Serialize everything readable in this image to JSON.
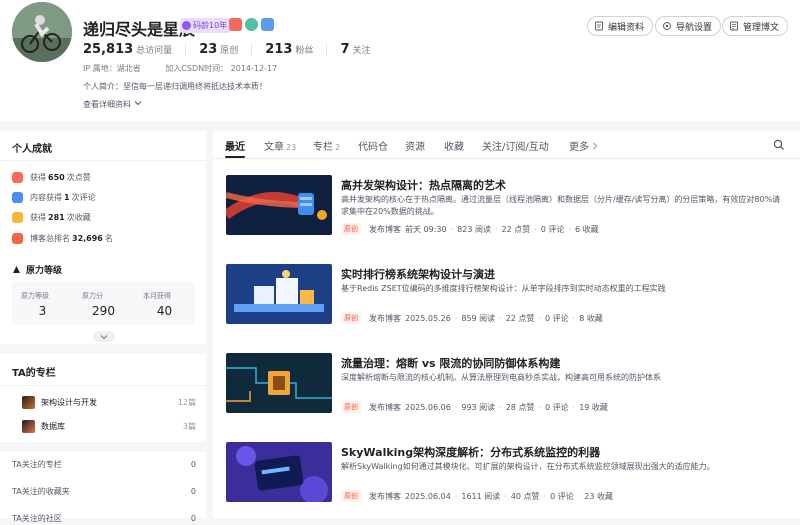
{
  "profile": {
    "name": "递归尽头是星辰",
    "age_badge": "码龄10年",
    "stats": [
      {
        "num": "25,813",
        "label": "总访问量"
      },
      {
        "num": "23",
        "label": "原创"
      },
      {
        "num": "213",
        "label": "粉丝"
      },
      {
        "num": "7",
        "label": "关注"
      }
    ],
    "ip": "IP 属地：湖北省",
    "joined": "加入CSDN时间： 2014-12-17",
    "bio": "个人简介：坚信每一层递归调用终将抵达技术本质！",
    "more_info": "查看详细资料"
  },
  "header_buttons": {
    "edit": "编辑资料",
    "nav": "导航设置",
    "manage": "管理博文"
  },
  "achievements": {
    "title": "个人成就",
    "items": [
      {
        "pre": "获得",
        "num": "650",
        "post": "次点赞",
        "color": "#ff6b5a"
      },
      {
        "pre": "内容获得",
        "num": "1",
        "post": "次评论",
        "color": "#4e8bf5"
      },
      {
        "pre": "获得",
        "num": "281",
        "post": "次收藏",
        "color": "#f6b73c"
      },
      {
        "pre": "博客总排名",
        "num": "32,696",
        "post": "名",
        "color": "#f5683d"
      }
    ],
    "level_title": "原力等级",
    "level": [
      {
        "label": "原力等级",
        "value": "3"
      },
      {
        "label": "原力分",
        "value": "290"
      },
      {
        "label": "本月获得",
        "value": "40"
      }
    ]
  },
  "columns": {
    "title": "TA的专栏",
    "items": [
      {
        "name": "架构设计与开发",
        "count": "12篇"
      },
      {
        "name": "数据库",
        "count": "3篇"
      }
    ]
  },
  "follows": [
    {
      "label": "TA关注的专栏",
      "count": "0"
    },
    {
      "label": "TA关注的收藏夹",
      "count": "0"
    },
    {
      "label": "TA关注的社区",
      "count": "0"
    }
  ],
  "tabs": [
    {
      "label": "最近",
      "count": ""
    },
    {
      "label": "文章",
      "count": "23"
    },
    {
      "label": "专栏",
      "count": "2"
    },
    {
      "label": "代码仓",
      "count": ""
    },
    {
      "label": "资源",
      "count": ""
    },
    {
      "label": "收藏",
      "count": ""
    },
    {
      "label": "关注/订阅/互动",
      "count": ""
    },
    {
      "label": "更多",
      "count": ""
    }
  ],
  "articles": [
    {
      "title": "高并发架构设计：热点隔离的艺术",
      "desc": "高并发架构的核心在于热点隔离。通过流量层（线程池隔离）和数据层（分片/缓存/读写分离）的分层策略，有效应对80%请求集中在20%数据的挑战。",
      "tag": "原创",
      "action": "发布博客",
      "date": "前天 09:30",
      "views": "823 阅读",
      "likes": "22 点赞",
      "comments": "0 评论",
      "favs": "6 收藏"
    },
    {
      "title": "实时排行榜系统架构设计与演进",
      "desc": "基于Redis ZSET位编码的多维度排行榜架构设计：从单字段排序到实时动态权重的工程实践",
      "tag": "原创",
      "action": "发布博客",
      "date": "2025.05.26",
      "views": "859 阅读",
      "likes": "22 点赞",
      "comments": "0 评论",
      "favs": "8 收藏"
    },
    {
      "title": "流量治理：熔断 vs 限流的协同防御体系构建",
      "desc": "深度解析熔断与限流的核心机制。从算法原理到电商秒杀实战，构建高可用系统的防护体系",
      "tag": "原创",
      "action": "发布博客",
      "date": "2025.06.06",
      "views": "993 阅读",
      "likes": "28 点赞",
      "comments": "0 评论",
      "favs": "19 收藏"
    },
    {
      "title": "SkyWalking架构深度解析：分布式系统监控的利器",
      "desc": "解析SkyWalking如何通过其模块化、可扩展的架构设计，在分布式系统监控领域展现出强大的适应能力。",
      "tag": "原创",
      "action": "发布博客",
      "date": "2025.06.04",
      "views": "1611 阅读",
      "likes": "40 点赞",
      "comments": "0 评论",
      "favs": "23 收藏"
    }
  ]
}
